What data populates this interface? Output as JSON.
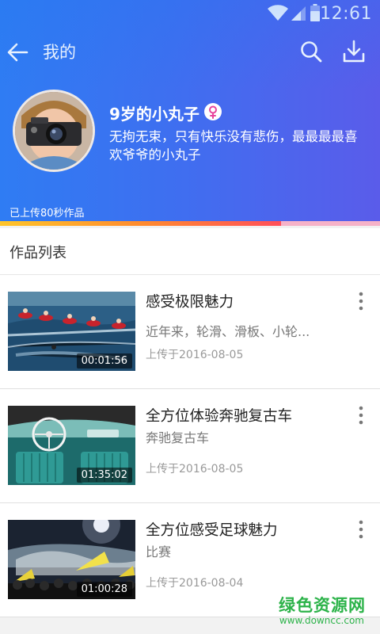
{
  "status": {
    "time": "12:61"
  },
  "appbar": {
    "title": "我的"
  },
  "profile": {
    "name": "9岁的小丸子",
    "bio": "无拘无束，只有快乐没有悲伤，最最最最喜欢爷爷的小丸子",
    "upload_summary": "已上传80秒作品",
    "upload_progress": 0.74
  },
  "section": {
    "title": "作品列表"
  },
  "works": [
    {
      "title": "感受极限魅力",
      "subtitle": "近年来，轮滑、滑板、小轮...",
      "date": "上传于2016-08-05",
      "duration": "00:01:56"
    },
    {
      "title": "全方位体验奔驰复古车",
      "subtitle": "奔驰复古车",
      "date": "上传于2016-08-05",
      "duration": "01:35:02"
    },
    {
      "title": "全方位感受足球魅力",
      "subtitle": "比赛",
      "date": "上传于2016-08-04",
      "duration": "01:00:28"
    }
  ],
  "watermark": {
    "text": "绿色资源网",
    "url": "www.downcc.com"
  },
  "colors": {
    "header_start": "#2f7cf3",
    "header_end": "#5a5cea",
    "progress_fill": "#ff6a3d",
    "progress_track": "#f6b2c8",
    "female": "#e8439c"
  }
}
